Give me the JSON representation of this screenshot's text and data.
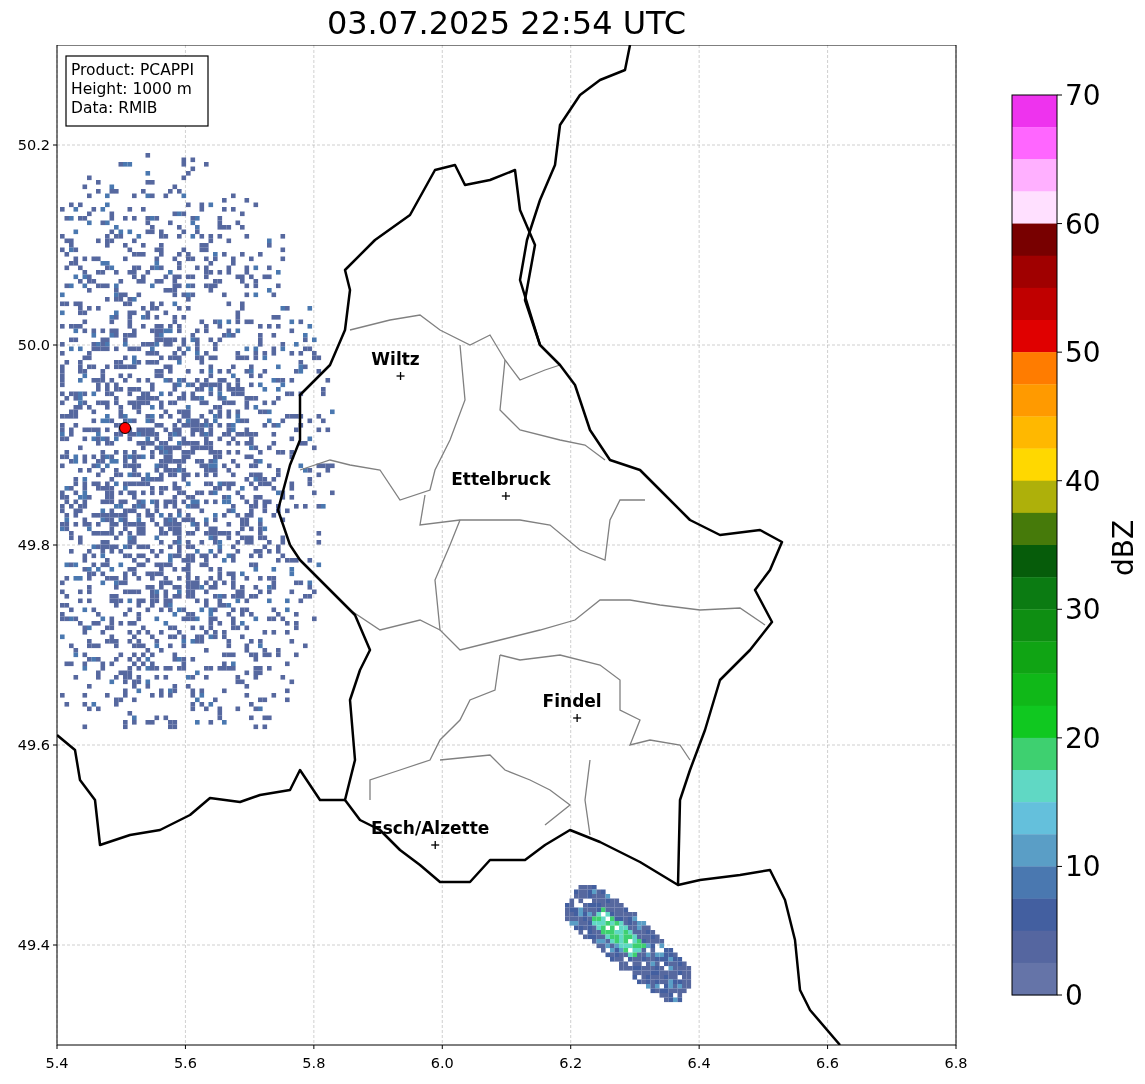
{
  "title": "03.07.2025 22:54 UTC",
  "legend_box": {
    "lines": [
      "Product: PCAPPI",
      "Height: 1000 m",
      "Data: RMIB"
    ]
  },
  "map": {
    "x_ticks": [
      "5.4",
      "5.6",
      "5.8",
      "6.0",
      "6.2",
      "6.4",
      "6.6",
      "6.8"
    ],
    "y_ticks": [
      "50.2",
      "50.0",
      "49.8",
      "49.6",
      "49.4"
    ],
    "cities": [
      {
        "name": "Wiltz"
      },
      {
        "name": "Ettelbruck"
      },
      {
        "name": "Findel"
      },
      {
        "name": "Esch/Alzette"
      }
    ]
  },
  "colorbar": {
    "label": "dBZ",
    "ticks": [
      "70",
      "60",
      "50",
      "40",
      "30",
      "20",
      "10",
      "0"
    ],
    "bands": [
      {
        "color": "#ee33ee"
      },
      {
        "color": "#ff66ff"
      },
      {
        "color": "#ffb0ff"
      },
      {
        "color": "#ffe0ff"
      },
      {
        "color": "#780000"
      },
      {
        "color": "#a00000"
      },
      {
        "color": "#c00000"
      },
      {
        "color": "#e00000"
      },
      {
        "color": "#ff7c00"
      },
      {
        "color": "#ff9a00"
      },
      {
        "color": "#ffb800"
      },
      {
        "color": "#ffd800"
      },
      {
        "color": "#aeb00a"
      },
      {
        "color": "#467a0a"
      },
      {
        "color": "#065c0a"
      },
      {
        "color": "#0b7b12"
      },
      {
        "color": "#0e8e12"
      },
      {
        "color": "#10a414"
      },
      {
        "color": "#10b818"
      },
      {
        "color": "#10c820"
      },
      {
        "color": "#3ed070"
      },
      {
        "color": "#60d8c4"
      },
      {
        "color": "#64c0dc"
      },
      {
        "color": "#5a9ec6"
      },
      {
        "color": "#4a78b0"
      },
      {
        "color": "#435fa0"
      },
      {
        "color": "#5566a0"
      },
      {
        "color": "#6574a8"
      }
    ]
  }
}
